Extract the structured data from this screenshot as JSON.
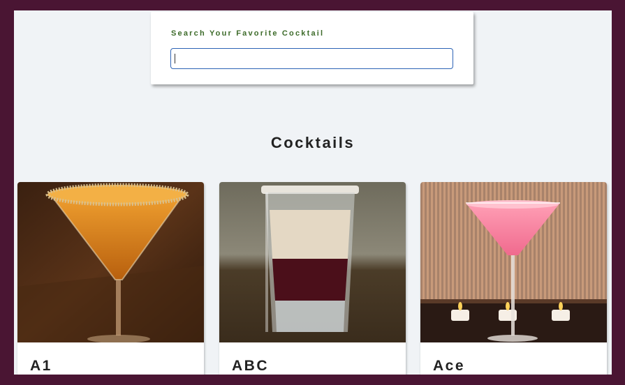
{
  "search": {
    "label": "Search Your Favorite Cocktail",
    "value": ""
  },
  "section": {
    "title": "Cocktails"
  },
  "cocktails": [
    {
      "name": "A1"
    },
    {
      "name": "ABC"
    },
    {
      "name": "Ace"
    }
  ]
}
